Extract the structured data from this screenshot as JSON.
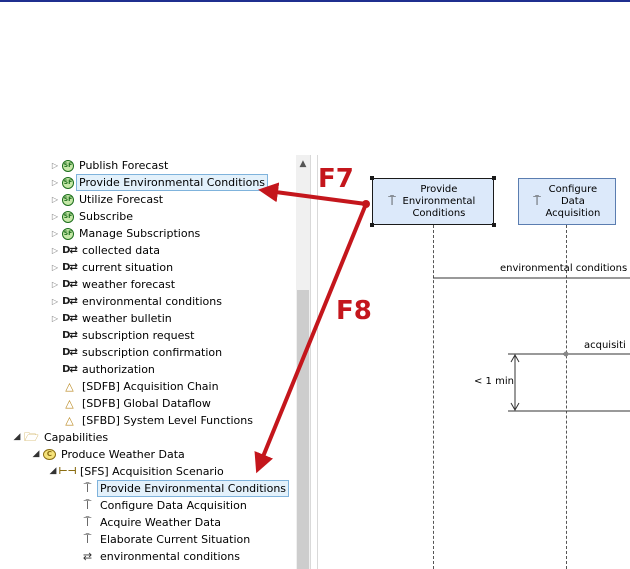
{
  "tree": {
    "rows": [
      {
        "label": "Publish Forecast",
        "icon": "function-icon",
        "twisty": "collapsed"
      },
      {
        "label": "Provide Environmental Conditions",
        "icon": "function-icon",
        "twisty": "collapsed",
        "selected": true
      },
      {
        "label": "Utilize Forecast",
        "icon": "function-icon",
        "twisty": "collapsed"
      },
      {
        "label": "Subscribe",
        "icon": "function-icon",
        "twisty": "collapsed"
      },
      {
        "label": "Manage Subscriptions",
        "icon": "function-icon",
        "twisty": "collapsed"
      },
      {
        "label": "collected data",
        "icon": "exchange-item-icon",
        "twisty": "collapsed"
      },
      {
        "label": "current situation",
        "icon": "exchange-item-icon",
        "twisty": "collapsed"
      },
      {
        "label": "weather forecast",
        "icon": "exchange-item-icon",
        "twisty": "collapsed"
      },
      {
        "label": "environmental conditions",
        "icon": "exchange-item-icon",
        "twisty": "collapsed"
      },
      {
        "label": "weather bulletin",
        "icon": "exchange-item-icon",
        "twisty": "collapsed"
      },
      {
        "label": "subscription request",
        "icon": "exchange-item-icon",
        "twisty": ""
      },
      {
        "label": "subscription confirmation",
        "icon": "exchange-item-icon",
        "twisty": ""
      },
      {
        "label": "authorization",
        "icon": "exchange-item-icon",
        "twisty": ""
      },
      {
        "label": "[SDFB] Acquisition Chain",
        "icon": "diagram-icon",
        "twisty": ""
      },
      {
        "label": "[SDFB] Global Dataflow",
        "icon": "diagram-icon",
        "twisty": ""
      },
      {
        "label": "[SFBD] System Level Functions",
        "icon": "diagram-icon",
        "twisty": ""
      },
      {
        "label": "Capabilities",
        "icon": "folder-icon",
        "twisty": "expanded"
      },
      {
        "label": "Produce Weather Data",
        "icon": "capability-icon",
        "twisty": "expanded"
      },
      {
        "label": "[SFS] Acquisition Scenario",
        "icon": "scenario-icon",
        "twisty": "expanded"
      },
      {
        "label": "Provide Environmental Conditions",
        "icon": "instance-role-icon",
        "twisty": "",
        "selected": true
      },
      {
        "label": "Configure Data Acquisition",
        "icon": "instance-role-icon",
        "twisty": ""
      },
      {
        "label": "Acquire Weather Data",
        "icon": "instance-role-icon",
        "twisty": ""
      },
      {
        "label": "Elaborate Current Situation",
        "icon": "instance-role-icon",
        "twisty": ""
      },
      {
        "label": "environmental conditions",
        "icon": "exchange-message-icon",
        "twisty": ""
      }
    ]
  },
  "diagram": {
    "lifelines": [
      {
        "label": "Provide Environmental Conditions",
        "active": true
      },
      {
        "label": "Configure Data Acquisition",
        "active": false
      }
    ],
    "messages": [
      {
        "label": "environmental conditions"
      },
      {
        "label": "acquisiti"
      }
    ],
    "constraint": "< 1 min"
  },
  "annotations": {
    "f7": "F7",
    "f8": "F8",
    "color": "#c4161c"
  }
}
